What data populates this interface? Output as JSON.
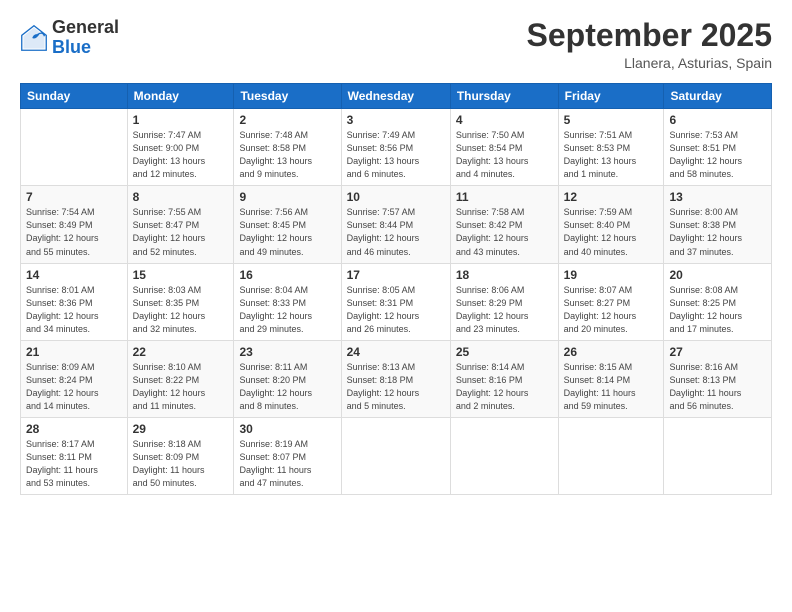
{
  "logo": {
    "general": "General",
    "blue": "Blue"
  },
  "header": {
    "month": "September 2025",
    "location": "Llanera, Asturias, Spain"
  },
  "weekdays": [
    "Sunday",
    "Monday",
    "Tuesday",
    "Wednesday",
    "Thursday",
    "Friday",
    "Saturday"
  ],
  "weeks": [
    [
      {
        "day": "",
        "info": ""
      },
      {
        "day": "1",
        "info": "Sunrise: 7:47 AM\nSunset: 9:00 PM\nDaylight: 13 hours\nand 12 minutes."
      },
      {
        "day": "2",
        "info": "Sunrise: 7:48 AM\nSunset: 8:58 PM\nDaylight: 13 hours\nand 9 minutes."
      },
      {
        "day": "3",
        "info": "Sunrise: 7:49 AM\nSunset: 8:56 PM\nDaylight: 13 hours\nand 6 minutes."
      },
      {
        "day": "4",
        "info": "Sunrise: 7:50 AM\nSunset: 8:54 PM\nDaylight: 13 hours\nand 4 minutes."
      },
      {
        "day": "5",
        "info": "Sunrise: 7:51 AM\nSunset: 8:53 PM\nDaylight: 13 hours\nand 1 minute."
      },
      {
        "day": "6",
        "info": "Sunrise: 7:53 AM\nSunset: 8:51 PM\nDaylight: 12 hours\nand 58 minutes."
      }
    ],
    [
      {
        "day": "7",
        "info": "Sunrise: 7:54 AM\nSunset: 8:49 PM\nDaylight: 12 hours\nand 55 minutes."
      },
      {
        "day": "8",
        "info": "Sunrise: 7:55 AM\nSunset: 8:47 PM\nDaylight: 12 hours\nand 52 minutes."
      },
      {
        "day": "9",
        "info": "Sunrise: 7:56 AM\nSunset: 8:45 PM\nDaylight: 12 hours\nand 49 minutes."
      },
      {
        "day": "10",
        "info": "Sunrise: 7:57 AM\nSunset: 8:44 PM\nDaylight: 12 hours\nand 46 minutes."
      },
      {
        "day": "11",
        "info": "Sunrise: 7:58 AM\nSunset: 8:42 PM\nDaylight: 12 hours\nand 43 minutes."
      },
      {
        "day": "12",
        "info": "Sunrise: 7:59 AM\nSunset: 8:40 PM\nDaylight: 12 hours\nand 40 minutes."
      },
      {
        "day": "13",
        "info": "Sunrise: 8:00 AM\nSunset: 8:38 PM\nDaylight: 12 hours\nand 37 minutes."
      }
    ],
    [
      {
        "day": "14",
        "info": "Sunrise: 8:01 AM\nSunset: 8:36 PM\nDaylight: 12 hours\nand 34 minutes."
      },
      {
        "day": "15",
        "info": "Sunrise: 8:03 AM\nSunset: 8:35 PM\nDaylight: 12 hours\nand 32 minutes."
      },
      {
        "day": "16",
        "info": "Sunrise: 8:04 AM\nSunset: 8:33 PM\nDaylight: 12 hours\nand 29 minutes."
      },
      {
        "day": "17",
        "info": "Sunrise: 8:05 AM\nSunset: 8:31 PM\nDaylight: 12 hours\nand 26 minutes."
      },
      {
        "day": "18",
        "info": "Sunrise: 8:06 AM\nSunset: 8:29 PM\nDaylight: 12 hours\nand 23 minutes."
      },
      {
        "day": "19",
        "info": "Sunrise: 8:07 AM\nSunset: 8:27 PM\nDaylight: 12 hours\nand 20 minutes."
      },
      {
        "day": "20",
        "info": "Sunrise: 8:08 AM\nSunset: 8:25 PM\nDaylight: 12 hours\nand 17 minutes."
      }
    ],
    [
      {
        "day": "21",
        "info": "Sunrise: 8:09 AM\nSunset: 8:24 PM\nDaylight: 12 hours\nand 14 minutes."
      },
      {
        "day": "22",
        "info": "Sunrise: 8:10 AM\nSunset: 8:22 PM\nDaylight: 12 hours\nand 11 minutes."
      },
      {
        "day": "23",
        "info": "Sunrise: 8:11 AM\nSunset: 8:20 PM\nDaylight: 12 hours\nand 8 minutes."
      },
      {
        "day": "24",
        "info": "Sunrise: 8:13 AM\nSunset: 8:18 PM\nDaylight: 12 hours\nand 5 minutes."
      },
      {
        "day": "25",
        "info": "Sunrise: 8:14 AM\nSunset: 8:16 PM\nDaylight: 12 hours\nand 2 minutes."
      },
      {
        "day": "26",
        "info": "Sunrise: 8:15 AM\nSunset: 8:14 PM\nDaylight: 11 hours\nand 59 minutes."
      },
      {
        "day": "27",
        "info": "Sunrise: 8:16 AM\nSunset: 8:13 PM\nDaylight: 11 hours\nand 56 minutes."
      }
    ],
    [
      {
        "day": "28",
        "info": "Sunrise: 8:17 AM\nSunset: 8:11 PM\nDaylight: 11 hours\nand 53 minutes."
      },
      {
        "day": "29",
        "info": "Sunrise: 8:18 AM\nSunset: 8:09 PM\nDaylight: 11 hours\nand 50 minutes."
      },
      {
        "day": "30",
        "info": "Sunrise: 8:19 AM\nSunset: 8:07 PM\nDaylight: 11 hours\nand 47 minutes."
      },
      {
        "day": "",
        "info": ""
      },
      {
        "day": "",
        "info": ""
      },
      {
        "day": "",
        "info": ""
      },
      {
        "day": "",
        "info": ""
      }
    ]
  ]
}
